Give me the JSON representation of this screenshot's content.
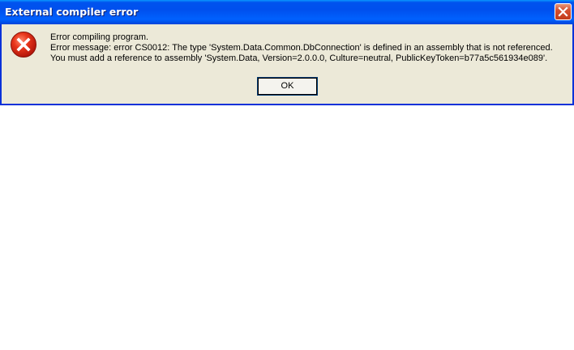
{
  "window": {
    "title": "External compiler error",
    "close_icon": "close-icon",
    "titlebar_color": "#0054e3"
  },
  "dialog": {
    "icon": "error-icon",
    "icon_color": "#d8240b",
    "line1": "Error compiling program.",
    "line2": "Error message:  error CS0012: The type 'System.Data.Common.DbConnection' is defined in an assembly that is not referenced. You must add a reference to assembly 'System.Data, Version=2.0.0.0, Culture=neutral, PublicKeyToken=b77a5c561934e089'.",
    "ok_label": "OK"
  }
}
